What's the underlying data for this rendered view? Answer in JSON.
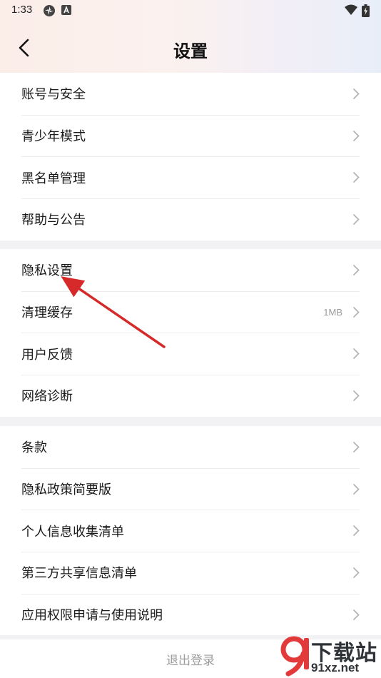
{
  "status_bar": {
    "time": "1:33"
  },
  "header": {
    "title": "设置"
  },
  "groups": [
    {
      "items": [
        {
          "label": "账号与安全"
        },
        {
          "label": "青少年模式"
        },
        {
          "label": "黑名单管理"
        },
        {
          "label": "帮助与公告"
        }
      ]
    },
    {
      "items": [
        {
          "label": "隐私设置"
        },
        {
          "label": "清理缓存",
          "value": "1MB"
        },
        {
          "label": "用户反馈"
        },
        {
          "label": "网络诊断"
        }
      ]
    },
    {
      "items": [
        {
          "label": "条款"
        },
        {
          "label": "隐私政策简要版"
        },
        {
          "label": "个人信息收集清单"
        },
        {
          "label": "第三方共享信息清单"
        },
        {
          "label": "应用权限申请与使用说明"
        }
      ]
    }
  ],
  "logout": {
    "label": "退出登录"
  },
  "watermark": {
    "line1": "下载站",
    "line2": "91xz.net"
  },
  "colors": {
    "annotation_arrow": "#d62a2a",
    "watermark_red": "#e23a3a"
  }
}
